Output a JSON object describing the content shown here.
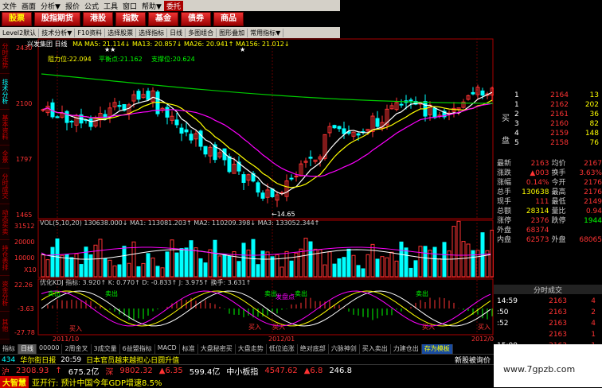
{
  "menubar": {
    "items": [
      "文件",
      "画面",
      "分析▼",
      "报价",
      "公式",
      "工具",
      "窗口",
      "帮助▼"
    ],
    "badge": "委托"
  },
  "top_buttons": [
    "股票",
    "股指期货",
    "港股",
    "指数",
    "基金",
    "债券",
    "商品"
  ],
  "toolbar": [
    "Level2默认",
    "技术分析▼",
    "F10资料",
    "选择股票",
    "选择指标",
    "日线",
    "多图组合",
    "图形叠加",
    "常用指标▼"
  ],
  "left_tabs": [
    "分时走势",
    "技术分析",
    "基本资料",
    "全景",
    "分时成交",
    "动态买卖",
    "持仓表排",
    "资金分析",
    "其他"
  ],
  "main_chart": {
    "title": "兴发集团 日线",
    "ma_line": "MA   MA5: 21.114↓ MA13: 20.857↓ MA26: 20.941↑ MA156: 21.012↓",
    "pressure_label": "阻力位:22.094",
    "balance_label": "平衡点:21.162",
    "support_label": "支撑位:20.624",
    "y_ticks": [
      "2430",
      "2100",
      "1797",
      "1465"
    ],
    "low_label": "←14.65",
    "star1": "★★",
    "star2": "★"
  },
  "vol_chart": {
    "header": "VOL(5,10,20)  130638.000↓  MA1: 113081.203↑  MA2: 110209.398↓  MA3: 133052.344↑",
    "y_ticks": [
      "31512",
      "20000",
      "10000"
    ],
    "x_tag": "X10"
  },
  "kdj_chart": {
    "header": "优化KDJ 指标: 3.920↑  K: 0.770↑  D: -0.833↑  J: 3.975↑  换手: 3.631↑",
    "y_ticks": [
      "22.26",
      "-3.63",
      "-27.78"
    ],
    "labels": [
      "卖出",
      "卖出",
      "卖出",
      "卖出",
      "卖出",
      "买入",
      "买入",
      "买入",
      "买入",
      "买入",
      "买入",
      "发盘点"
    ],
    "x_ticks": [
      "2011/10",
      "2012/01",
      "2012/04"
    ]
  },
  "order_book": {
    "sell_side_label": "买",
    "buy_side_label": "盘",
    "rows": [
      {
        "n": "1",
        "p": "2164",
        "v": "13"
      },
      {
        "n": "1",
        "p": "2162",
        "v": "202"
      },
      {
        "n": "2",
        "p": "2161",
        "v": "36"
      },
      {
        "n": "3",
        "p": "2160",
        "v": "82"
      },
      {
        "n": "4",
        "p": "2159",
        "v": "148"
      },
      {
        "n": "5",
        "p": "2158",
        "v": "76"
      }
    ]
  },
  "quote": [
    {
      "k1": "最新",
      "v1": "2163",
      "k2": "均价",
      "v2": "2167"
    },
    {
      "k1": "涨跌",
      "v1": "▲003",
      "k2": "换手",
      "v2": "3.63%"
    },
    {
      "k1": "涨幅",
      "v1": "0.14%",
      "k2": "今开",
      "v2": "2176"
    },
    {
      "k1": "总手",
      "v1": "130638",
      "k2": "最高",
      "v2": "2176"
    },
    {
      "k1": "现手",
      "v1": "111",
      "k2": "最低",
      "v2": "2149"
    },
    {
      "k1": "总额",
      "v1": "28314",
      "k2": "量比",
      "v2": "0.94"
    },
    {
      "k1": "涨停",
      "v1": "2376",
      "k2": "跌停",
      "v2": "1944"
    },
    {
      "k1": "外盘",
      "v1": "68374",
      "k2": "",
      "v2": ""
    },
    {
      "k1": "内盘",
      "v1": "62573",
      "k2": "外盘",
      "v2": "68065"
    }
  ],
  "trades_header": "分时成交",
  "trades": [
    {
      "t": "14:59",
      "p": "2163",
      "v": "4"
    },
    {
      "t": ":50",
      "p": "2163",
      "v": "2"
    },
    {
      "t": ":52",
      "p": "2163",
      "v": "4"
    },
    {
      "t": "",
      "p": "2163",
      "v": "1"
    },
    {
      "t": "15:00",
      "p": "2163",
      "v": "1"
    },
    {
      "t": ":05",
      "p": "2163",
      "v": "1"
    }
  ],
  "bottom_tabs": [
    "指标",
    "日线",
    "00000",
    "2周金叉",
    "3成交量",
    "6益盟指标",
    "MACD",
    "标准",
    "大盘秘密买",
    "大盘走势",
    "低位追涨",
    "绝对底部",
    "六脉神剑",
    "买入卖出",
    "力建仓出",
    "存为模板"
  ],
  "news": {
    "code": "434",
    "text1": "华尔街日报",
    "time": "20:59",
    "text2": "日本官员越来越担心日圆升值",
    "right": "新股被询价"
  },
  "index_bar": {
    "sh": "沪",
    "sh_val": "2308.93",
    "sh_arrow": "↑",
    "sh_vol": "675.2亿",
    "sz": "深",
    "sz_val": "9802.32",
    "sz_chg": "▲6.35",
    "sz_amt": "599.4亿",
    "mid": "中小板指",
    "mid_val": "4547.62",
    "mid_chg": "▲6.8",
    "mid_amt": "246.8"
  },
  "ticker": {
    "tag": "大智慧",
    "text": "亚开行: 预计中国今年GDP增速8.5%"
  },
  "watermark": "www.7gpzb.com"
}
